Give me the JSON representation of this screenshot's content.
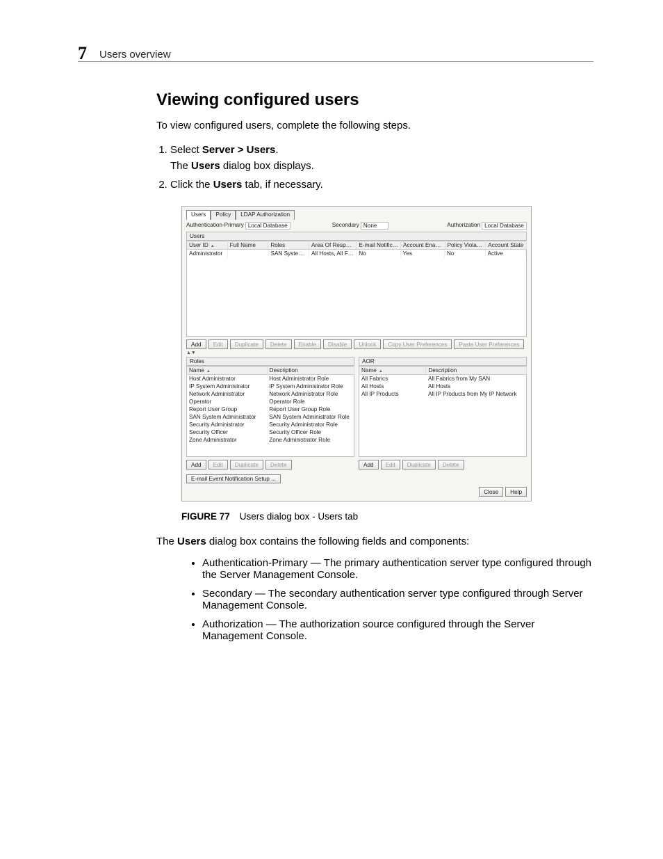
{
  "header": {
    "page_number": "7",
    "section": "Users overview"
  },
  "title": "Viewing configured users",
  "intro": "To view configured users, complete the following steps.",
  "steps": [
    {
      "pre": "Select ",
      "bold": "Server > Users",
      "post": ".",
      "sub_pre": "The ",
      "sub_bold": "Users",
      "sub_post": " dialog box displays."
    },
    {
      "pre": "Click the ",
      "bold": "Users",
      "post": " tab, if necessary."
    }
  ],
  "dialog": {
    "tabs": [
      "Users",
      "Policy",
      "LDAP Authorization"
    ],
    "info": {
      "auth_primary_label": "Authentication-Primary",
      "auth_primary_value": "Local Database",
      "secondary_label": "Secondary",
      "secondary_value": "None",
      "authorization_label": "Authorization",
      "authorization_value": "Local Database"
    },
    "users_panel_label": "Users",
    "users_columns": [
      "User ID",
      "Full Name",
      "Roles",
      "Area Of Respon..",
      "E-mail Notification",
      "Account Enabled",
      "Policy Violations",
      "Account State"
    ],
    "users_rows": [
      [
        "Administrator",
        "",
        "SAN System Ad...",
        "All Hosts, All Fab...",
        "No",
        "Yes",
        "No",
        "Active"
      ]
    ],
    "users_buttons": [
      "Add",
      "Edit",
      "Duplicate",
      "Delete",
      "Enable",
      "Disable",
      "Unlock",
      "Copy User Preferences",
      "Paste User Preferences"
    ],
    "roles_panel_label": "Roles",
    "roles_columns": [
      "Name",
      "Description"
    ],
    "roles_rows": [
      [
        "Host Administrator",
        "Host Administrator Role"
      ],
      [
        "IP System Administrator",
        "IP System Administrator Role"
      ],
      [
        "Network Administrator",
        "Network Administrator Role"
      ],
      [
        "Operator",
        "Operator Role"
      ],
      [
        "Report User Group",
        "Report User Group Role"
      ],
      [
        "SAN System Administrator",
        "SAN System Administrator Role"
      ],
      [
        "Security Administrator",
        "Security Administrator Role"
      ],
      [
        "Security Officer",
        "Security Officer Role"
      ],
      [
        "Zone Administrator",
        "Zone Administrator Role"
      ]
    ],
    "aor_panel_label": "AOR",
    "aor_columns": [
      "Name",
      "Description"
    ],
    "aor_rows": [
      [
        "All Fabrics",
        "All Fabrics from My SAN"
      ],
      [
        "All Hosts",
        "All Hosts"
      ],
      [
        "All IP Products",
        "All IP Products from My IP Network"
      ]
    ],
    "small_buttons": [
      "Add",
      "Edit",
      "Duplicate",
      "Delete"
    ],
    "email_setup": "E-mail Event Notification Setup ...",
    "footer_buttons": [
      "Close",
      "Help"
    ]
  },
  "figure": {
    "label": "FIGURE 77",
    "caption": "Users dialog box - Users tab"
  },
  "after_pre": "The ",
  "after_bold": "Users",
  "after_post": " dialog box contains the following fields and components:",
  "bullets": [
    "Authentication-Primary — The primary authentication server type configured through the Server Management Console.",
    "Secondary — The secondary authentication server type configured through Server Management Console.",
    "Authorization — The authorization source configured through the Server Management Console."
  ]
}
